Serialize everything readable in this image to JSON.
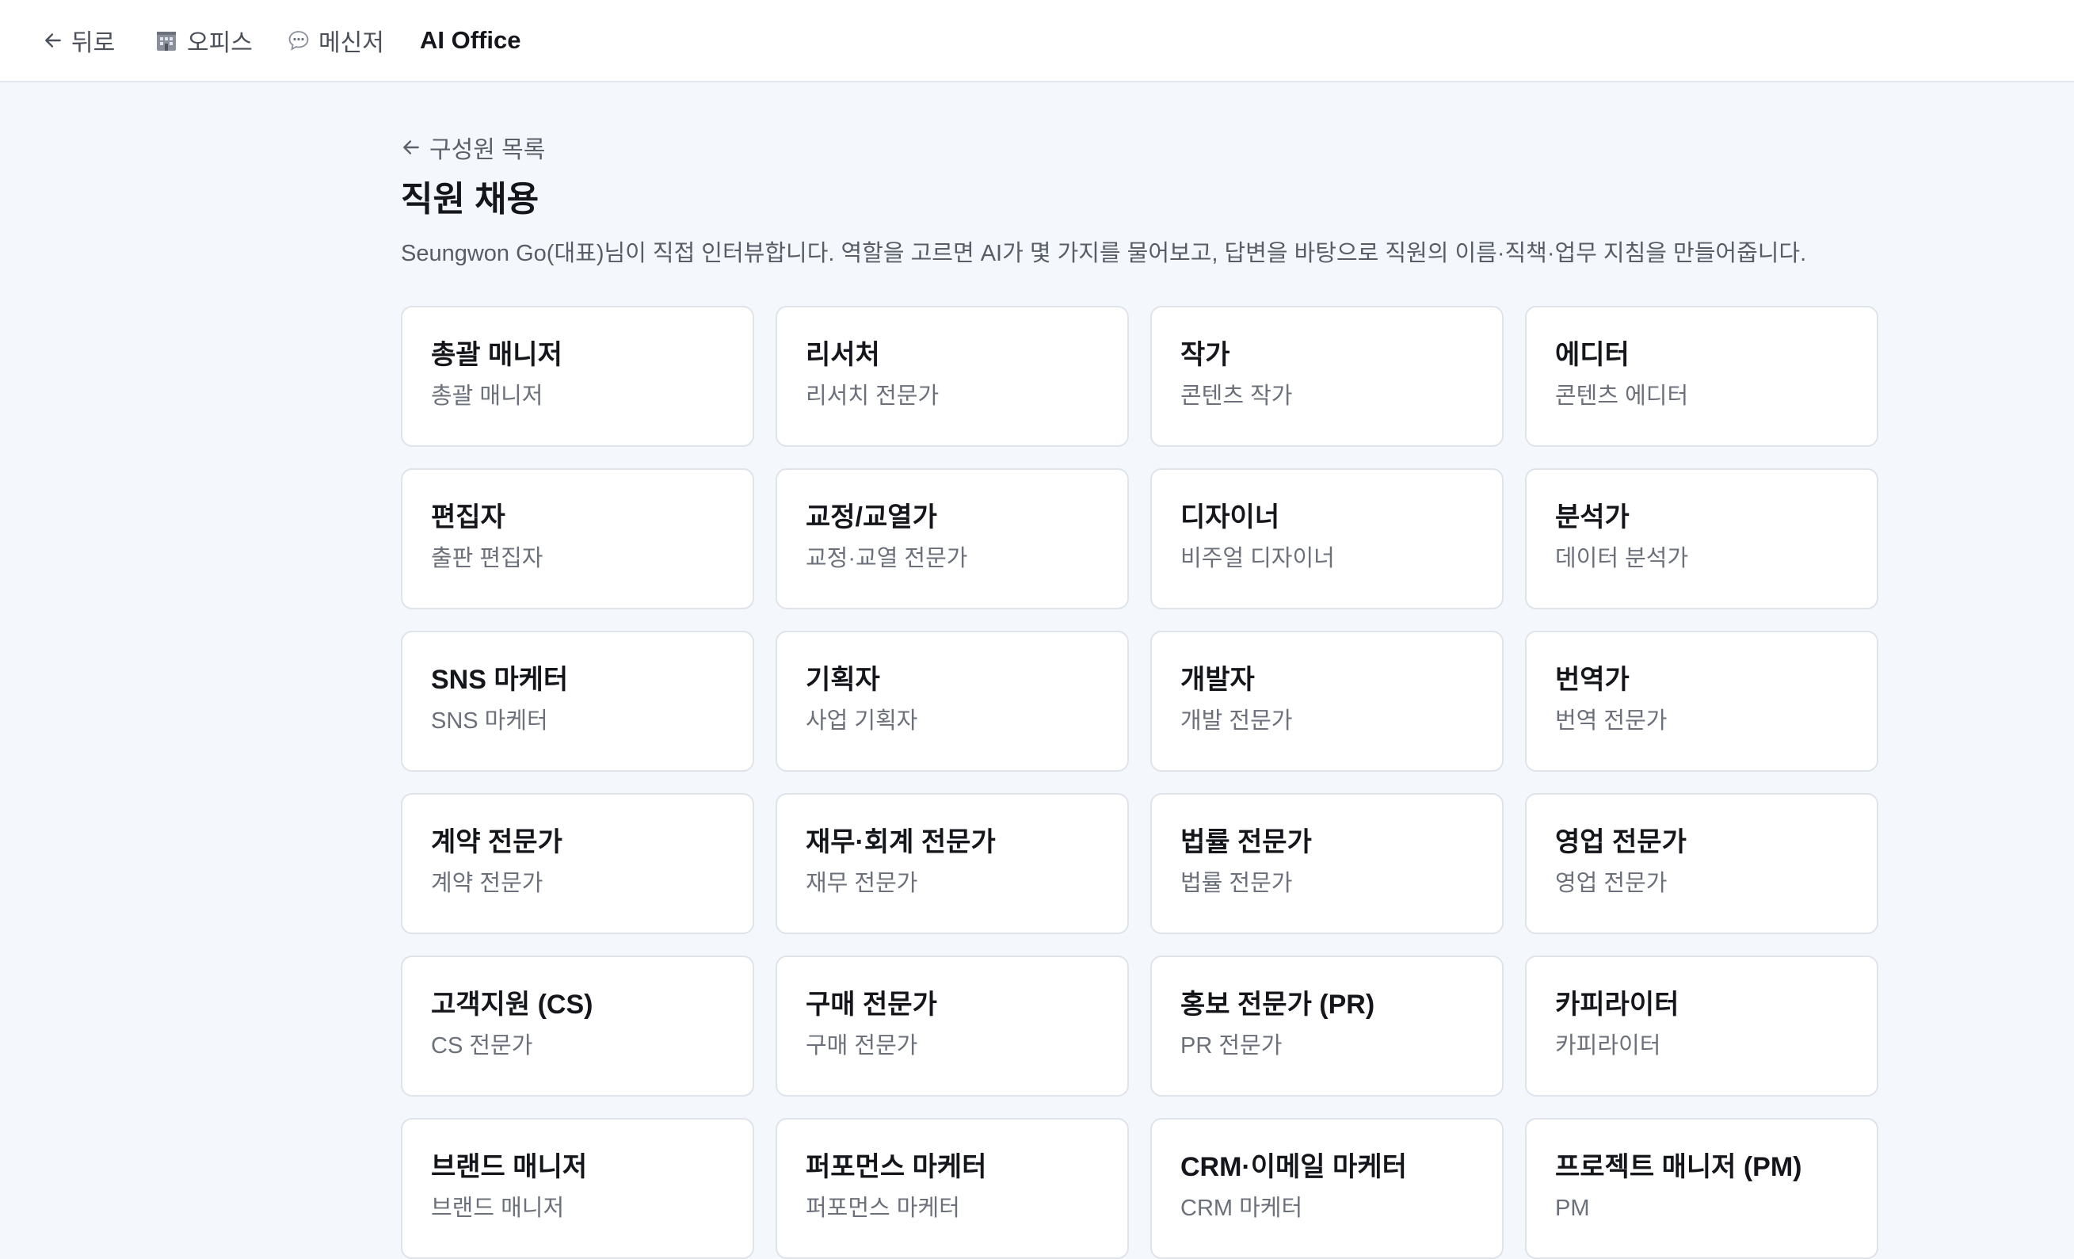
{
  "nav": {
    "back_label": "뒤로",
    "office_label": "오피스",
    "messenger_label": "메신저",
    "brand": "AI Office"
  },
  "page": {
    "back_link": "구성원 목록",
    "title": "직원 채용",
    "description": "Seungwon Go(대표)님이 직접 인터뷰합니다. 역할을 고르면 AI가 몇 가지를 물어보고, 답변을 바탕으로 직원의 이름·직책·업무 지침을 만들어줍니다."
  },
  "roles": [
    {
      "title": "총괄 매니저",
      "subtitle": "총괄 매니저"
    },
    {
      "title": "리서처",
      "subtitle": "리서치 전문가"
    },
    {
      "title": "작가",
      "subtitle": "콘텐츠 작가"
    },
    {
      "title": "에디터",
      "subtitle": "콘텐츠 에디터"
    },
    {
      "title": "편집자",
      "subtitle": "출판 편집자"
    },
    {
      "title": "교정/교열가",
      "subtitle": "교정·교열 전문가"
    },
    {
      "title": "디자이너",
      "subtitle": "비주얼 디자이너"
    },
    {
      "title": "분석가",
      "subtitle": "데이터 분석가"
    },
    {
      "title": "SNS 마케터",
      "subtitle": "SNS 마케터"
    },
    {
      "title": "기획자",
      "subtitle": "사업 기획자"
    },
    {
      "title": "개발자",
      "subtitle": "개발 전문가"
    },
    {
      "title": "번역가",
      "subtitle": "번역 전문가"
    },
    {
      "title": "계약 전문가",
      "subtitle": "계약 전문가"
    },
    {
      "title": "재무·회계 전문가",
      "subtitle": "재무 전문가"
    },
    {
      "title": "법률 전문가",
      "subtitle": "법률 전문가"
    },
    {
      "title": "영업 전문가",
      "subtitle": "영업 전문가"
    },
    {
      "title": "고객지원 (CS)",
      "subtitle": "CS 전문가"
    },
    {
      "title": "구매 전문가",
      "subtitle": "구매 전문가"
    },
    {
      "title": "홍보 전문가 (PR)",
      "subtitle": "PR 전문가"
    },
    {
      "title": "카피라이터",
      "subtitle": "카피라이터"
    },
    {
      "title": "브랜드 매니저",
      "subtitle": "브랜드 매니저"
    },
    {
      "title": "퍼포먼스 마케터",
      "subtitle": "퍼포먼스 마케터"
    },
    {
      "title": "CRM·이메일 마케터",
      "subtitle": "CRM 마케터"
    },
    {
      "title": "프로젝트 매니저 (PM)",
      "subtitle": "PM"
    }
  ]
}
